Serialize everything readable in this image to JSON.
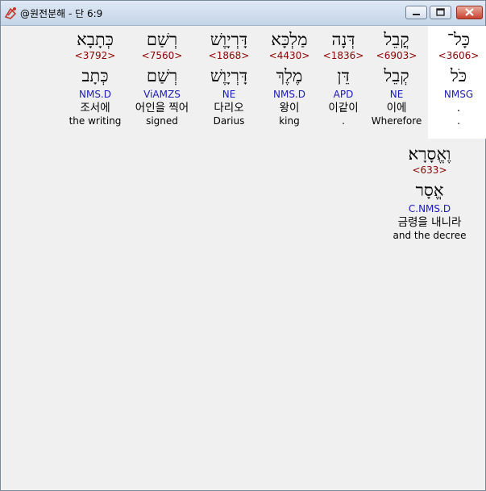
{
  "window": {
    "title": "@원전분해 - 단 6:9"
  },
  "words": [
    {
      "heb": "כָּל־",
      "strong": "<3606>",
      "lemma": "כֹּל",
      "morph": "NMSG",
      "kor": ".",
      "eng": "."
    },
    {
      "heb": "קֳבֵל",
      "strong": "<6903>",
      "lemma": "קְבֵל",
      "morph": "NE",
      "kor": "이에",
      "eng": "Wherefore"
    },
    {
      "heb": "דְּנָה",
      "strong": "<1836>",
      "lemma": "דֵּן",
      "morph": "APD",
      "kor": "이같이",
      "eng": "."
    },
    {
      "heb": "מַלְכָּא",
      "strong": "<4430>",
      "lemma": "מֶלֶךְ",
      "morph": "NMS.D",
      "kor": "왕이",
      "eng": "king"
    },
    {
      "heb": "דָּרְיָוֶשׁ",
      "strong": "<1868>",
      "lemma": "דָּרְיָוֶשׁ",
      "morph": "NE",
      "kor": "다리오",
      "eng": "Darius"
    },
    {
      "heb": "רְשַׁם",
      "strong": "<7560>",
      "lemma": "רְשַׁם",
      "morph": "ViAMZS",
      "kor": "어인을 찍어",
      "eng": "signed"
    },
    {
      "heb": "כְּתָבָא",
      "strong": "<3792>",
      "lemma": "כְּתָב",
      "morph": "NMS.D",
      "kor": "조서에",
      "eng": "the writing"
    },
    {
      "heb": "וֶאֱסָרָא׃",
      "strong": "<633>",
      "lemma": "אֱסָר",
      "morph": "C.NMS.D",
      "kor": "금령을 내니라",
      "eng": "and the decree"
    }
  ]
}
